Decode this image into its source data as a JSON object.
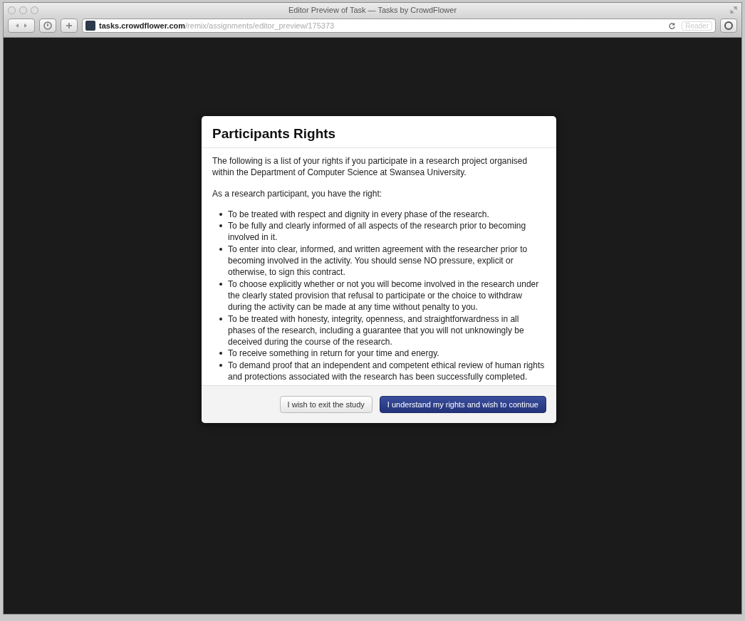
{
  "window": {
    "title": "Editor Preview of Task — Tasks by CrowdFlower"
  },
  "toolbar": {
    "url_host": "tasks.crowdflower.com",
    "url_path": "/remix/assignments/editor_preview/175373",
    "reader_label": "Reader"
  },
  "dialog": {
    "title": "Participants Rights",
    "intro": "The following is a list of your rights if you participate in a research project organised within the Department of Computer Science at Swansea University.",
    "lead": "As a research participant, you have the right:",
    "rights": [
      "To be treated with respect and dignity in every phase of the research.",
      "To be fully and clearly informed of all aspects of the research prior to becoming involved in it.",
      "To enter into clear, informed, and written agreement with the researcher prior to becoming involved in the activity. You should sense NO pressure, explicit or otherwise, to sign this contract.",
      "To choose explicitly whether or not you will become involved in the research under the clearly stated provision that refusal to participate or the choice to withdraw during the activity can be made at any time without penalty to you.",
      "To be treated with honesty, integrity, openness, and straightforwardness in all phases of the research, including a guarantee that you will not unknowingly be deceived during the course of the research.",
      "To receive something in return for your time and energy.",
      "To demand proof that an independent and competent ethical review of human rights and protections associated with the research has been successfully completed."
    ],
    "buttons": [
      {
        "label": "I wish to exit the study",
        "kind": "secondary"
      },
      {
        "label": "I understand my rights and wish to continue",
        "kind": "primary"
      }
    ]
  }
}
